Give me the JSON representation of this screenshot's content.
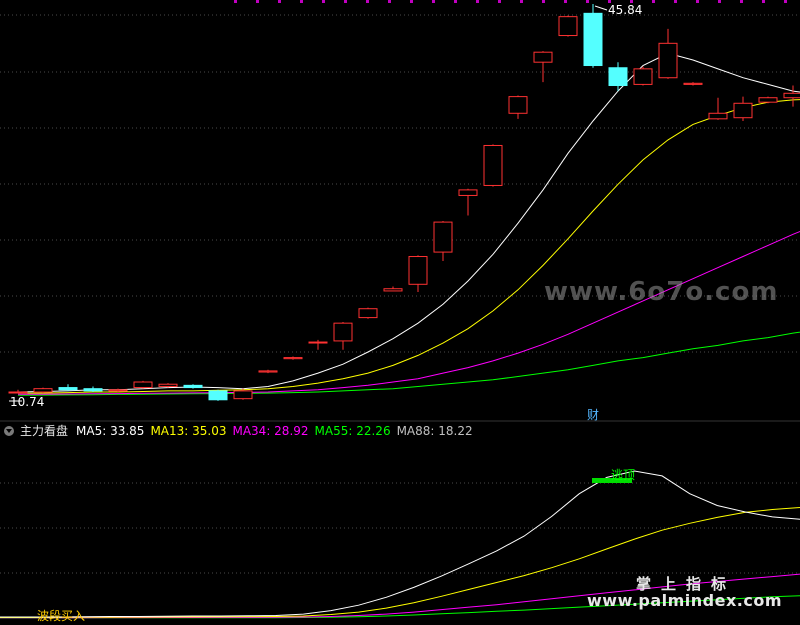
{
  "indicator": {
    "name": "主力看盘",
    "ma": [
      {
        "label": "MA5: 33.85",
        "color": "#ffffff"
      },
      {
        "label": "MA13: 35.03",
        "color": "#ffff00"
      },
      {
        "label": "MA34: 28.92",
        "color": "#ff00ff"
      },
      {
        "label": "MA55: 22.26",
        "color": "#00ff00"
      },
      {
        "label": "MA88: 18.22",
        "color": "#c0c0c0"
      }
    ]
  },
  "watermarks": {
    "site1": "www.6o7o.com",
    "brand": "掌上指标",
    "site2": "www.palmindex.com"
  },
  "chart_data": {
    "type": "candlestick",
    "price_high_label": "45.84",
    "price_low_label": "10.74",
    "marker_label": "财",
    "signal_top_label": "逃顶",
    "signal_buy_label": "波段买入",
    "colors": {
      "up": "#ff3232",
      "down": "#54ffff",
      "ma5": "#ffffff",
      "ma13": "#ffff00",
      "ma34": "#ff00ff",
      "ma55": "#00ff00",
      "ma88": "#c0c0c0"
    },
    "candles": [
      {
        "o": 10.9,
        "c": 10.9,
        "h": 11.1,
        "l": 10.8
      },
      {
        "o": 10.9,
        "c": 11.2,
        "h": 11.3,
        "l": 10.8
      },
      {
        "o": 11.3,
        "c": 11.1,
        "h": 11.6,
        "l": 11.0
      },
      {
        "o": 11.2,
        "c": 11.0,
        "h": 11.4,
        "l": 10.9
      },
      {
        "o": 11.0,
        "c": 11.1,
        "h": 11.2,
        "l": 10.9
      },
      {
        "o": 11.3,
        "c": 11.8,
        "h": 11.9,
        "l": 11.2
      },
      {
        "o": 11.4,
        "c": 11.6,
        "h": 11.7,
        "l": 11.3
      },
      {
        "o": 11.5,
        "c": 11.3,
        "h": 11.6,
        "l": 11.2
      },
      {
        "o": 11.0,
        "c": 10.2,
        "h": 11.1,
        "l": 10.1
      },
      {
        "o": 10.3,
        "c": 11.0,
        "h": 11.2,
        "l": 10.2
      },
      {
        "o": 12.7,
        "c": 12.8,
        "h": 12.9,
        "l": 12.6
      },
      {
        "o": 13.9,
        "c": 14.0,
        "h": 14.1,
        "l": 13.8
      },
      {
        "o": 15.4,
        "c": 15.4,
        "h": 15.6,
        "l": 14.7
      },
      {
        "o": 15.5,
        "c": 17.1,
        "h": 17.2,
        "l": 14.7
      },
      {
        "o": 17.6,
        "c": 18.4,
        "h": 18.5,
        "l": 17.5
      },
      {
        "o": 20.0,
        "c": 20.2,
        "h": 20.4,
        "l": 20.0
      },
      {
        "o": 20.6,
        "c": 23.1,
        "h": 23.2,
        "l": 19.9
      },
      {
        "o": 23.5,
        "c": 26.2,
        "h": 26.3,
        "l": 22.7
      },
      {
        "o": 28.6,
        "c": 29.1,
        "h": 29.2,
        "l": 26.8
      },
      {
        "o": 29.5,
        "c": 33.1,
        "h": 33.2,
        "l": 29.4
      },
      {
        "o": 36.0,
        "c": 37.5,
        "h": 37.6,
        "l": 35.5
      },
      {
        "o": 40.6,
        "c": 41.5,
        "h": 41.6,
        "l": 38.8
      },
      {
        "o": 43.0,
        "c": 44.7,
        "h": 44.8,
        "l": 42.9
      },
      {
        "o": 45.0,
        "c": 40.3,
        "h": 45.84,
        "l": 40.1
      },
      {
        "o": 40.1,
        "c": 38.5,
        "h": 40.6,
        "l": 38.0
      },
      {
        "o": 38.6,
        "c": 40.0,
        "h": 40.2,
        "l": 38.5
      },
      {
        "o": 39.2,
        "c": 42.3,
        "h": 43.6,
        "l": 39.1
      },
      {
        "o": 38.6,
        "c": 38.7,
        "h": 38.8,
        "l": 38.5
      },
      {
        "o": 35.5,
        "c": 36.0,
        "h": 37.4,
        "l": 35.4
      },
      {
        "o": 35.6,
        "c": 36.9,
        "h": 37.5,
        "l": 35.3
      },
      {
        "o": 37.0,
        "c": 37.4,
        "h": 37.5,
        "l": 36.9
      },
      {
        "o": 37.4,
        "c": 37.8,
        "h": 38.5,
        "l": 36.6
      },
      {
        "o": 37.9,
        "c": 37.9,
        "h": 38.6,
        "l": 36.5
      }
    ],
    "ma5": [
      10.9,
      10.95,
      11.0,
      11.1,
      11.1,
      11.2,
      11.3,
      11.35,
      11.3,
      11.2,
      11.4,
      11.9,
      12.6,
      13.4,
      14.5,
      15.7,
      17.1,
      18.8,
      20.9,
      23.3,
      26.1,
      29.1,
      32.4,
      35.3,
      38.0,
      40.3,
      41.4,
      40.8,
      40.0,
      39.2,
      38.6,
      38.0,
      37.7
    ],
    "ma13": [
      10.8,
      10.8,
      10.85,
      10.9,
      10.9,
      10.95,
      11.0,
      11.0,
      11.05,
      11.1,
      11.2,
      11.4,
      11.7,
      12.1,
      12.6,
      13.3,
      14.2,
      15.3,
      16.6,
      18.2,
      20.1,
      22.3,
      24.7,
      27.2,
      29.6,
      31.8,
      33.6,
      35.0,
      35.8,
      36.5,
      37.0,
      37.2,
      37.3
    ],
    "ma34": [
      10.7,
      10.7,
      10.72,
      10.74,
      10.76,
      10.78,
      10.8,
      10.82,
      10.84,
      10.86,
      10.9,
      11.0,
      11.1,
      11.3,
      11.5,
      11.8,
      12.1,
      12.6,
      13.1,
      13.7,
      14.4,
      15.2,
      16.1,
      17.1,
      18.1,
      19.1,
      20.1,
      21.1,
      22.1,
      23.1,
      24.1,
      25.1,
      26.0
    ],
    "ma55": [
      10.6,
      10.62,
      10.64,
      10.66,
      10.68,
      10.7,
      10.72,
      10.74,
      10.76,
      10.78,
      10.8,
      10.85,
      10.9,
      11.0,
      11.1,
      11.2,
      11.4,
      11.6,
      11.8,
      12.0,
      12.3,
      12.6,
      12.9,
      13.3,
      13.7,
      14.0,
      14.4,
      14.8,
      15.1,
      15.5,
      15.8,
      16.2,
      16.5
    ],
    "ind_ma5": [
      0.2,
      0.2,
      0.2,
      0.25,
      0.3,
      0.3,
      0.35,
      0.4,
      0.4,
      0.45,
      0.5,
      0.8,
      1.5,
      2.6,
      4.2,
      6.2,
      8.5,
      11.0,
      13.6,
      16.6,
      20.6,
      25.2,
      28.5,
      29.8,
      28.8,
      25.2,
      22.8,
      21.5,
      20.5,
      20.0
    ],
    "ind_ma13": [
      0.1,
      0.1,
      0.12,
      0.14,
      0.16,
      0.18,
      0.2,
      0.22,
      0.25,
      0.28,
      0.3,
      0.4,
      0.7,
      1.2,
      2.0,
      3.1,
      4.4,
      5.8,
      7.2,
      8.6,
      10.2,
      12.0,
      14.0,
      16.0,
      17.8,
      19.2,
      20.4,
      21.4,
      22.0,
      22.4
    ],
    "ind_ma34": [
      0.05,
      0.05,
      0.06,
      0.07,
      0.08,
      0.09,
      0.1,
      0.11,
      0.12,
      0.13,
      0.15,
      0.2,
      0.3,
      0.5,
      0.8,
      1.2,
      1.7,
      2.2,
      2.7,
      3.3,
      3.9,
      4.5,
      5.1,
      5.7,
      6.3,
      6.9,
      7.4,
      7.9,
      8.4,
      8.9
    ],
    "ind_ma55": [
      0.02,
      0.02,
      0.03,
      0.03,
      0.04,
      0.04,
      0.05,
      0.05,
      0.06,
      0.06,
      0.07,
      0.1,
      0.15,
      0.25,
      0.4,
      0.6,
      0.85,
      1.1,
      1.35,
      1.6,
      1.9,
      2.2,
      2.5,
      2.8,
      3.1,
      3.4,
      3.7,
      4.0,
      4.3,
      4.5
    ]
  }
}
